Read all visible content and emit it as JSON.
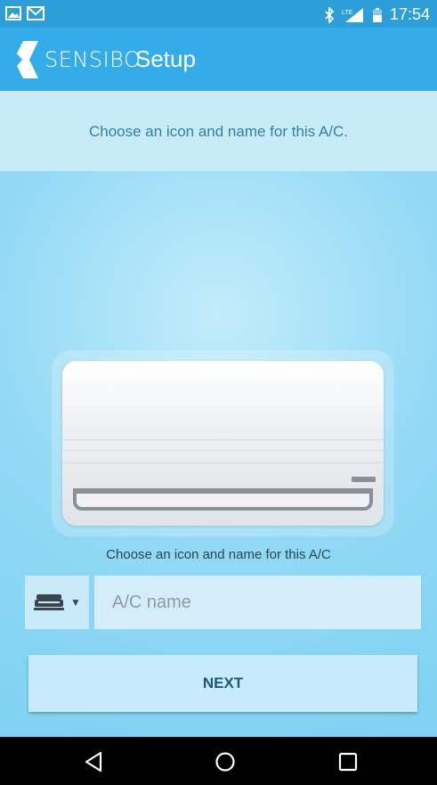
{
  "status_bar": {
    "time": "17:54",
    "network": "LTE"
  },
  "app_bar": {
    "brand": "SENSIBO",
    "title": "Setup"
  },
  "banner": {
    "text": "Choose an icon and name for this A/C."
  },
  "form": {
    "hint": "Choose an icon and name for this A/C",
    "name_placeholder": "A/C name",
    "name_value": "",
    "icon_caret": "▼"
  },
  "actions": {
    "next_label": "NEXT"
  },
  "colors": {
    "app_bar": "#34acea",
    "status_bar": "#2d9fd8",
    "button_text": "#1d5877"
  }
}
